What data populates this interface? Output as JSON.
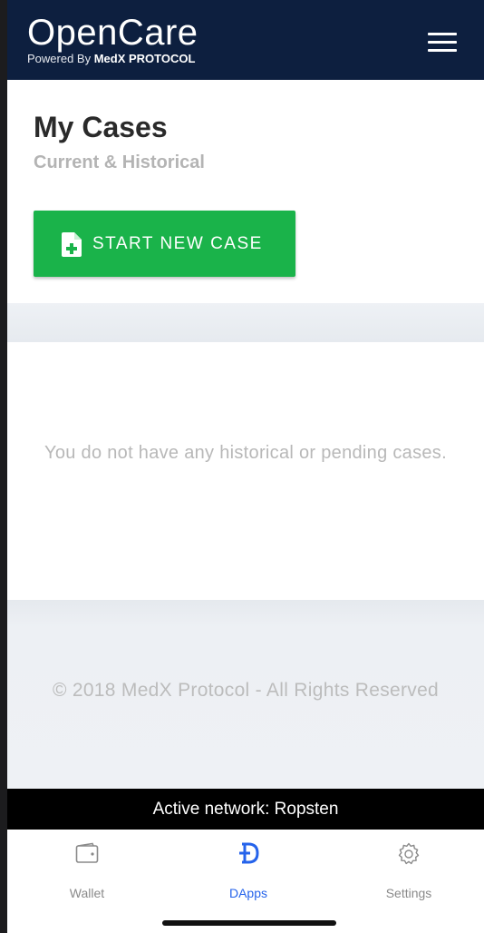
{
  "header": {
    "brand_title": "OpenCare",
    "brand_sub_prefix": "Powered By ",
    "brand_sub_bold": "MedX PROTOCOL",
    "menu_icon": "hamburger-menu-icon",
    "bg_color": "#0d1f3f"
  },
  "page": {
    "title": "My Cases",
    "subtitle": "Current & Historical",
    "start_button_label": "START NEW CASE",
    "start_button_icon": "document-plus-icon",
    "accent_color": "#1ab34a",
    "empty_message": "You do not have any historical or pending cases.",
    "copyright": "© 2018 MedX Protocol - All Rights Reserved"
  },
  "network": {
    "label": "Active network: Ropsten"
  },
  "tabs": [
    {
      "label": "Wallet",
      "icon": "wallet-icon",
      "active": false
    },
    {
      "label": "DApps",
      "icon": "dapps-icon",
      "active": true
    },
    {
      "label": "Settings",
      "icon": "gear-icon",
      "active": false
    }
  ],
  "colors": {
    "tab_active": "#2563eb",
    "tab_inactive": "#8a8a8a"
  }
}
